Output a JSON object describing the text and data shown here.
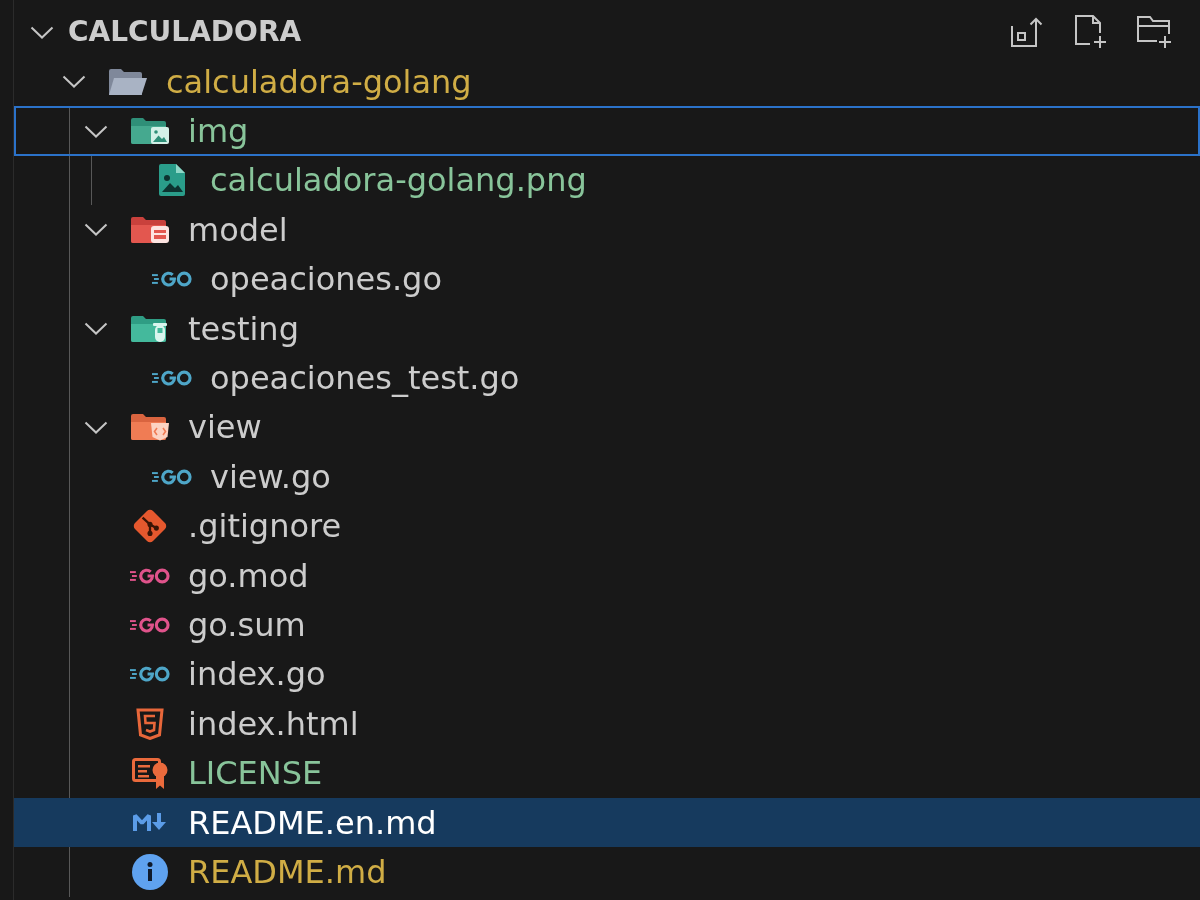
{
  "explorer": {
    "section": {
      "title": "CALCULADORA",
      "expanded": true
    },
    "tree": [
      {
        "name": "calculadora-golang",
        "kind": "folder",
        "expanded": true,
        "selected": false,
        "focused": false,
        "color": "#d0ad45",
        "children": [
          {
            "name": "img",
            "kind": "imagefolder",
            "expanded": true,
            "selected": false,
            "focused": true,
            "color": "#88c49a",
            "children": [
              {
                "name": "calculadora-golang.png",
                "kind": "image",
                "selected": false,
                "focused": false,
                "color": "#88c49a"
              }
            ]
          },
          {
            "name": "model",
            "kind": "modelfolder",
            "expanded": true,
            "selected": false,
            "focused": false,
            "children": [
              {
                "name": "opeaciones.go",
                "kind": "gofile",
                "selected": false,
                "focused": false
              }
            ]
          },
          {
            "name": "testing",
            "kind": "testfolder",
            "expanded": true,
            "selected": false,
            "focused": false,
            "children": [
              {
                "name": "opeaciones_test.go",
                "kind": "gofile",
                "selected": false,
                "focused": false
              }
            ]
          },
          {
            "name": "view",
            "kind": "viewfolder",
            "expanded": true,
            "selected": false,
            "focused": false,
            "children": [
              {
                "name": "view.go",
                "kind": "gofile",
                "selected": false,
                "focused": false
              }
            ]
          },
          {
            "name": ".gitignore",
            "kind": "gitignore",
            "selected": false,
            "focused": false
          },
          {
            "name": "go.mod",
            "kind": "gomod",
            "selected": false,
            "focused": false
          },
          {
            "name": "go.sum",
            "kind": "gomod",
            "selected": false,
            "focused": false
          },
          {
            "name": "index.go",
            "kind": "gofile",
            "selected": false,
            "focused": false
          },
          {
            "name": "index.html",
            "kind": "html",
            "selected": false,
            "focused": false
          },
          {
            "name": "LICENSE",
            "kind": "license",
            "selected": false,
            "focused": false,
            "color": "#88c49a"
          },
          {
            "name": "README.en.md",
            "kind": "markdown",
            "selected": true,
            "focused": false
          },
          {
            "name": "README.md",
            "kind": "info",
            "selected": false,
            "focused": false,
            "color": "#d0ad45"
          }
        ]
      }
    ]
  }
}
